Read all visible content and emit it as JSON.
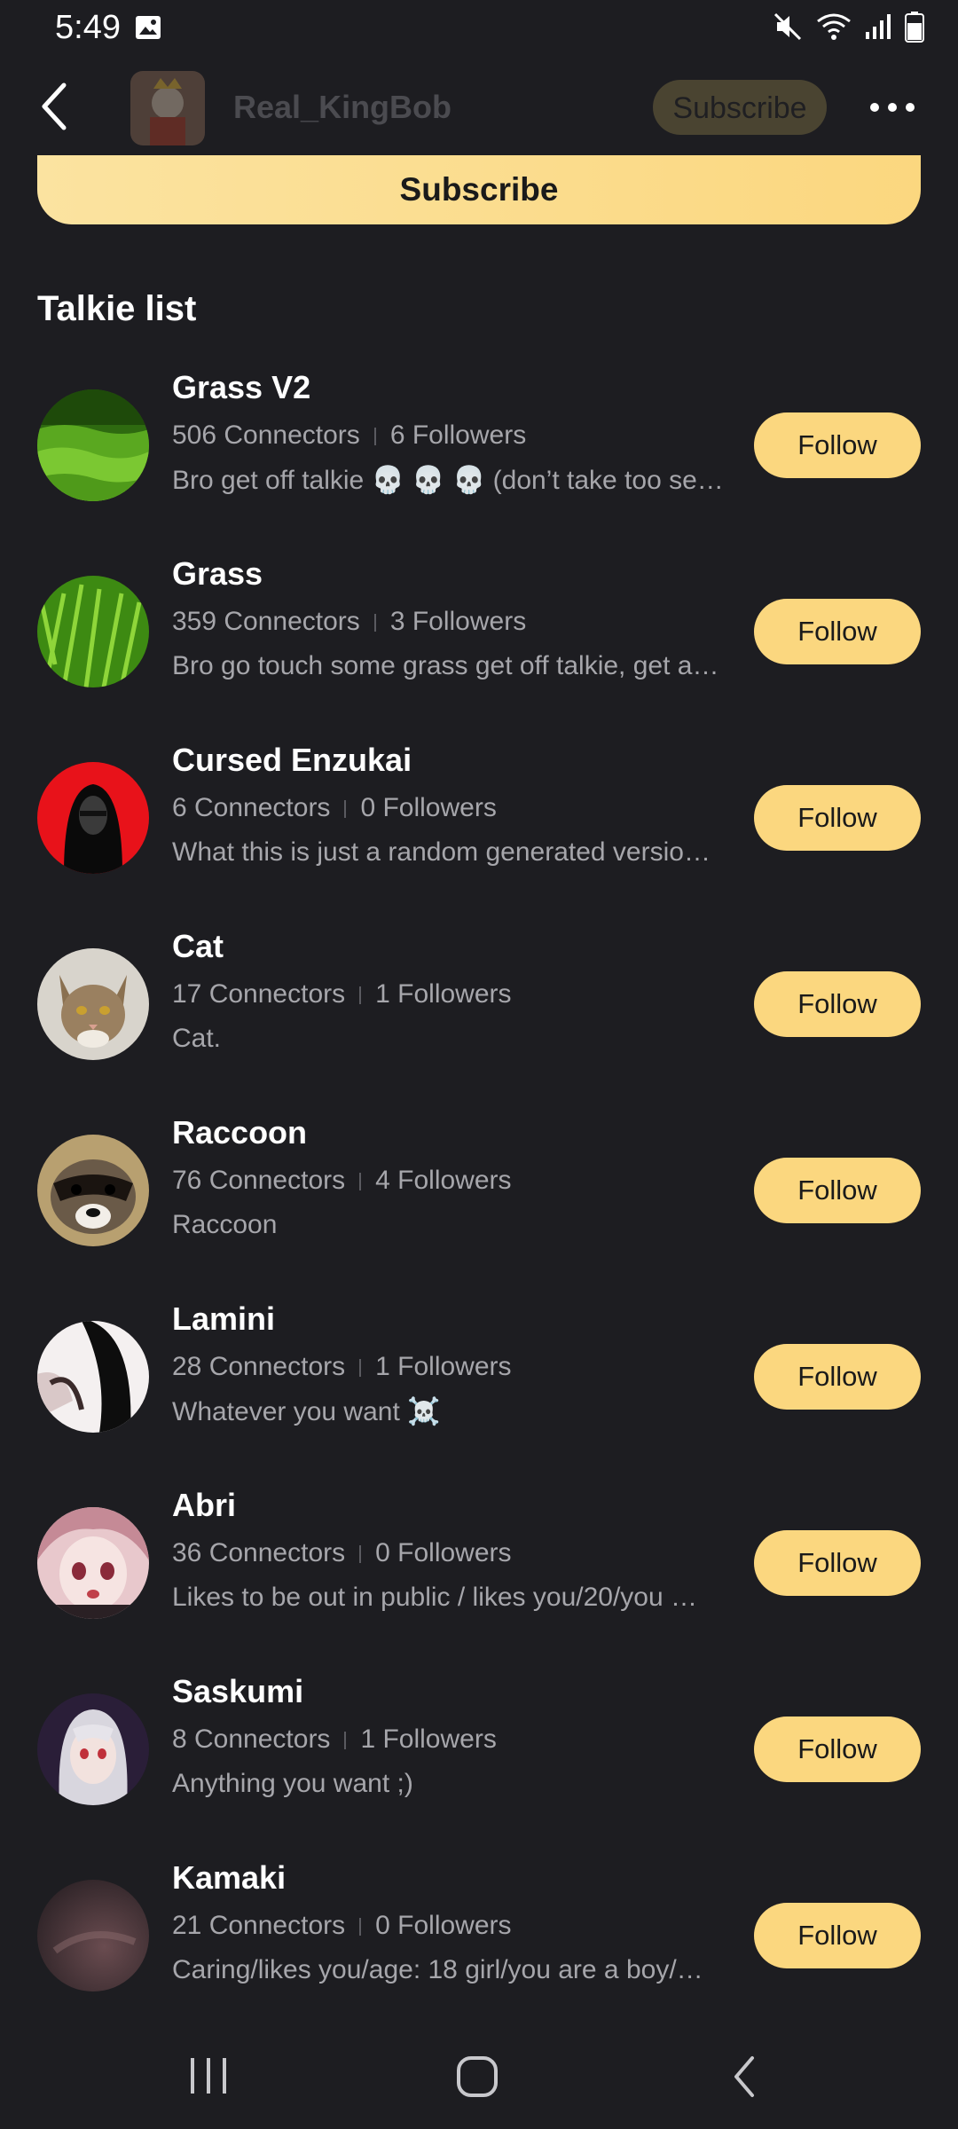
{
  "status_bar": {
    "time": "5:49",
    "icons": [
      "image-icon",
      "mute-icon",
      "wifi-icon",
      "signal-icon",
      "battery-icon"
    ]
  },
  "header": {
    "title": "Real_KingBob",
    "subscribe_label": "Subscribe",
    "icons": [
      "back-icon",
      "more-icon"
    ]
  },
  "main": {
    "subscribe_label": "Subscribe",
    "section_title": "Talkie list"
  },
  "list": [
    {
      "name": "Grass V2",
      "connectors": "506 Connectors",
      "followers": "6 Followers",
      "desc": "Bro get off talkie 💀 💀 💀 (don’t take too se…",
      "follow": "Follow"
    },
    {
      "name": "Grass",
      "connectors": "359 Connectors",
      "followers": "3 Followers",
      "desc": "Bro go touch some grass get off talkie, get a…",
      "follow": "Follow"
    },
    {
      "name": "Cursed Enzukai",
      "connectors": "6 Connectors",
      "followers": "0 Followers",
      "desc": "What this is just a random generated versio…",
      "follow": "Follow"
    },
    {
      "name": "Cat",
      "connectors": "17 Connectors",
      "followers": "1 Followers",
      "desc": "Cat.",
      "follow": "Follow"
    },
    {
      "name": "Raccoon",
      "connectors": "76 Connectors",
      "followers": "4 Followers",
      "desc": "Raccoon",
      "follow": "Follow"
    },
    {
      "name": "Lamini",
      "connectors": "28 Connectors",
      "followers": "1 Followers",
      "desc": "Whatever you want ☠️",
      "follow": "Follow"
    },
    {
      "name": "Abri",
      "connectors": "36 Connectors",
      "followers": "0 Followers",
      "desc": "Likes to be out in public / likes you/20/you …",
      "follow": "Follow"
    },
    {
      "name": "Saskumi",
      "connectors": "8 Connectors",
      "followers": "1 Followers",
      "desc": "Anything you want ;)",
      "follow": "Follow"
    },
    {
      "name": "Kamaki",
      "connectors": "21 Connectors",
      "followers": "0 Followers",
      "desc": "Caring/likes you/age: 18 girl/you are a boy/…",
      "follow": "Follow"
    }
  ],
  "nav_bar": {
    "icons": [
      "recent-apps-icon",
      "home-icon",
      "nav-back-icon"
    ]
  },
  "colors": {
    "background": "#1d1d21",
    "accent": "#fbd77f",
    "text_secondary": "#a6a6ab"
  }
}
